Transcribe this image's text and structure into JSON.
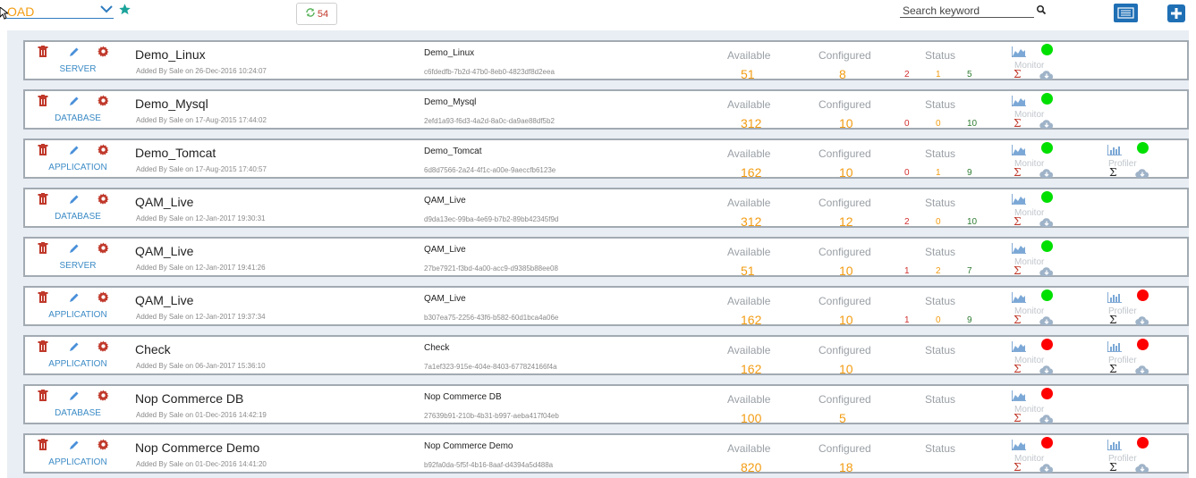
{
  "header": {
    "app_select_value": "OAD",
    "alert_count": "54",
    "search_placeholder": "Search keyword"
  },
  "labels": {
    "available": "Available",
    "configured": "Configured",
    "status": "Status",
    "monitor": "Monitor",
    "profiler": "Profiler"
  },
  "colors": {
    "accent": "#1f6fb5",
    "status_up": "#00e000",
    "status_down": "#ff0000",
    "count_orange": "#f39c12",
    "type_blue": "#3d8cc6"
  },
  "rows": [
    {
      "name": "Demo_Linux",
      "type": "SERVER",
      "added": "Added By Sale on 26-Dec-2016 10:24:07",
      "name2": "Demo_Linux",
      "guid": "c6fdedfb-7b2d-47b0-8eb0-4823df8d2eea",
      "available": "51",
      "configured": "8",
      "status": [
        "2",
        "1",
        "5"
      ],
      "monitor_status": "up",
      "profiler": false
    },
    {
      "name": "Demo_Mysql",
      "type": "DATABASE",
      "added": "Added By Sale on 17-Aug-2015 17:44:02",
      "name2": "Demo_Mysql",
      "guid": "2efd1a93-f6d3-4a2d-8a0c-da9ae88df5b2",
      "available": "312",
      "configured": "10",
      "status": [
        "0",
        "0",
        "10"
      ],
      "monitor_status": "up",
      "profiler": false
    },
    {
      "name": "Demo_Tomcat",
      "type": "APPLICATION",
      "added": "Added By Sale on 17-Aug-2015 17:40:57",
      "name2": "Demo_Tomcat",
      "guid": "6d8d7566-2a24-4f1c-a00e-9aeccfb6123e",
      "available": "162",
      "configured": "10",
      "status": [
        "0",
        "1",
        "9"
      ],
      "monitor_status": "up",
      "profiler": true,
      "profiler_status": "up"
    },
    {
      "name": "QAM_Live",
      "type": "DATABASE",
      "added": "Added By Sale on 12-Jan-2017 19:30:31",
      "name2": "QAM_Live",
      "guid": "d9da13ec-99ba-4e69-b7b2-89bb42345f9d",
      "available": "312",
      "configured": "12",
      "status": [
        "2",
        "0",
        "10"
      ],
      "monitor_status": "up",
      "profiler": false
    },
    {
      "name": "QAM_Live",
      "type": "SERVER",
      "added": "Added By Sale on 12-Jan-2017 19:41:26",
      "name2": "QAM_Live",
      "guid": "27be7921-f3bd-4a00-acc9-d9385b88ee08",
      "available": "51",
      "configured": "10",
      "status": [
        "1",
        "2",
        "7"
      ],
      "monitor_status": "up",
      "profiler": false
    },
    {
      "name": "QAM_Live",
      "type": "APPLICATION",
      "added": "Added By Sale on 12-Jan-2017 19:37:34",
      "name2": "QAM_Live",
      "guid": "b307ea75-2256-43f6-b582-60d1bca4a06e",
      "available": "162",
      "configured": "10",
      "status": [
        "1",
        "0",
        "9"
      ],
      "monitor_status": "up",
      "profiler": true,
      "profiler_status": "down"
    },
    {
      "name": "Check",
      "type": "APPLICATION",
      "added": "Added By Sale on 06-Jan-2017 15:36:10",
      "name2": "Check",
      "guid": "7a1ef323-915e-404e-8403-677824166f4a",
      "available": "162",
      "configured": "10",
      "status": [
        "",
        "",
        ""
      ],
      "monitor_status": "down",
      "profiler": true,
      "profiler_status": "down"
    },
    {
      "name": "Nop Commerce DB",
      "type": "DATABASE",
      "added": "Added By Sale on 01-Dec-2016 14:42:19",
      "name2": "Nop Commerce DB",
      "guid": "27639b91-210b-4b31-b997-aeba417f04eb",
      "available": "100",
      "configured": "5",
      "status": [
        "",
        "",
        ""
      ],
      "monitor_status": "down",
      "profiler": false
    },
    {
      "name": "Nop Commerce Demo",
      "type": "APPLICATION",
      "added": "Added By Sale on 01-Dec-2016 14:41:20",
      "name2": "Nop Commerce Demo",
      "guid": "b92fa0da-5f5f-4b16-8aaf-d4394a5d488a",
      "available": "820",
      "configured": "18",
      "status": [
        "",
        "",
        ""
      ],
      "monitor_status": "down",
      "profiler": true,
      "profiler_status": "down"
    }
  ]
}
